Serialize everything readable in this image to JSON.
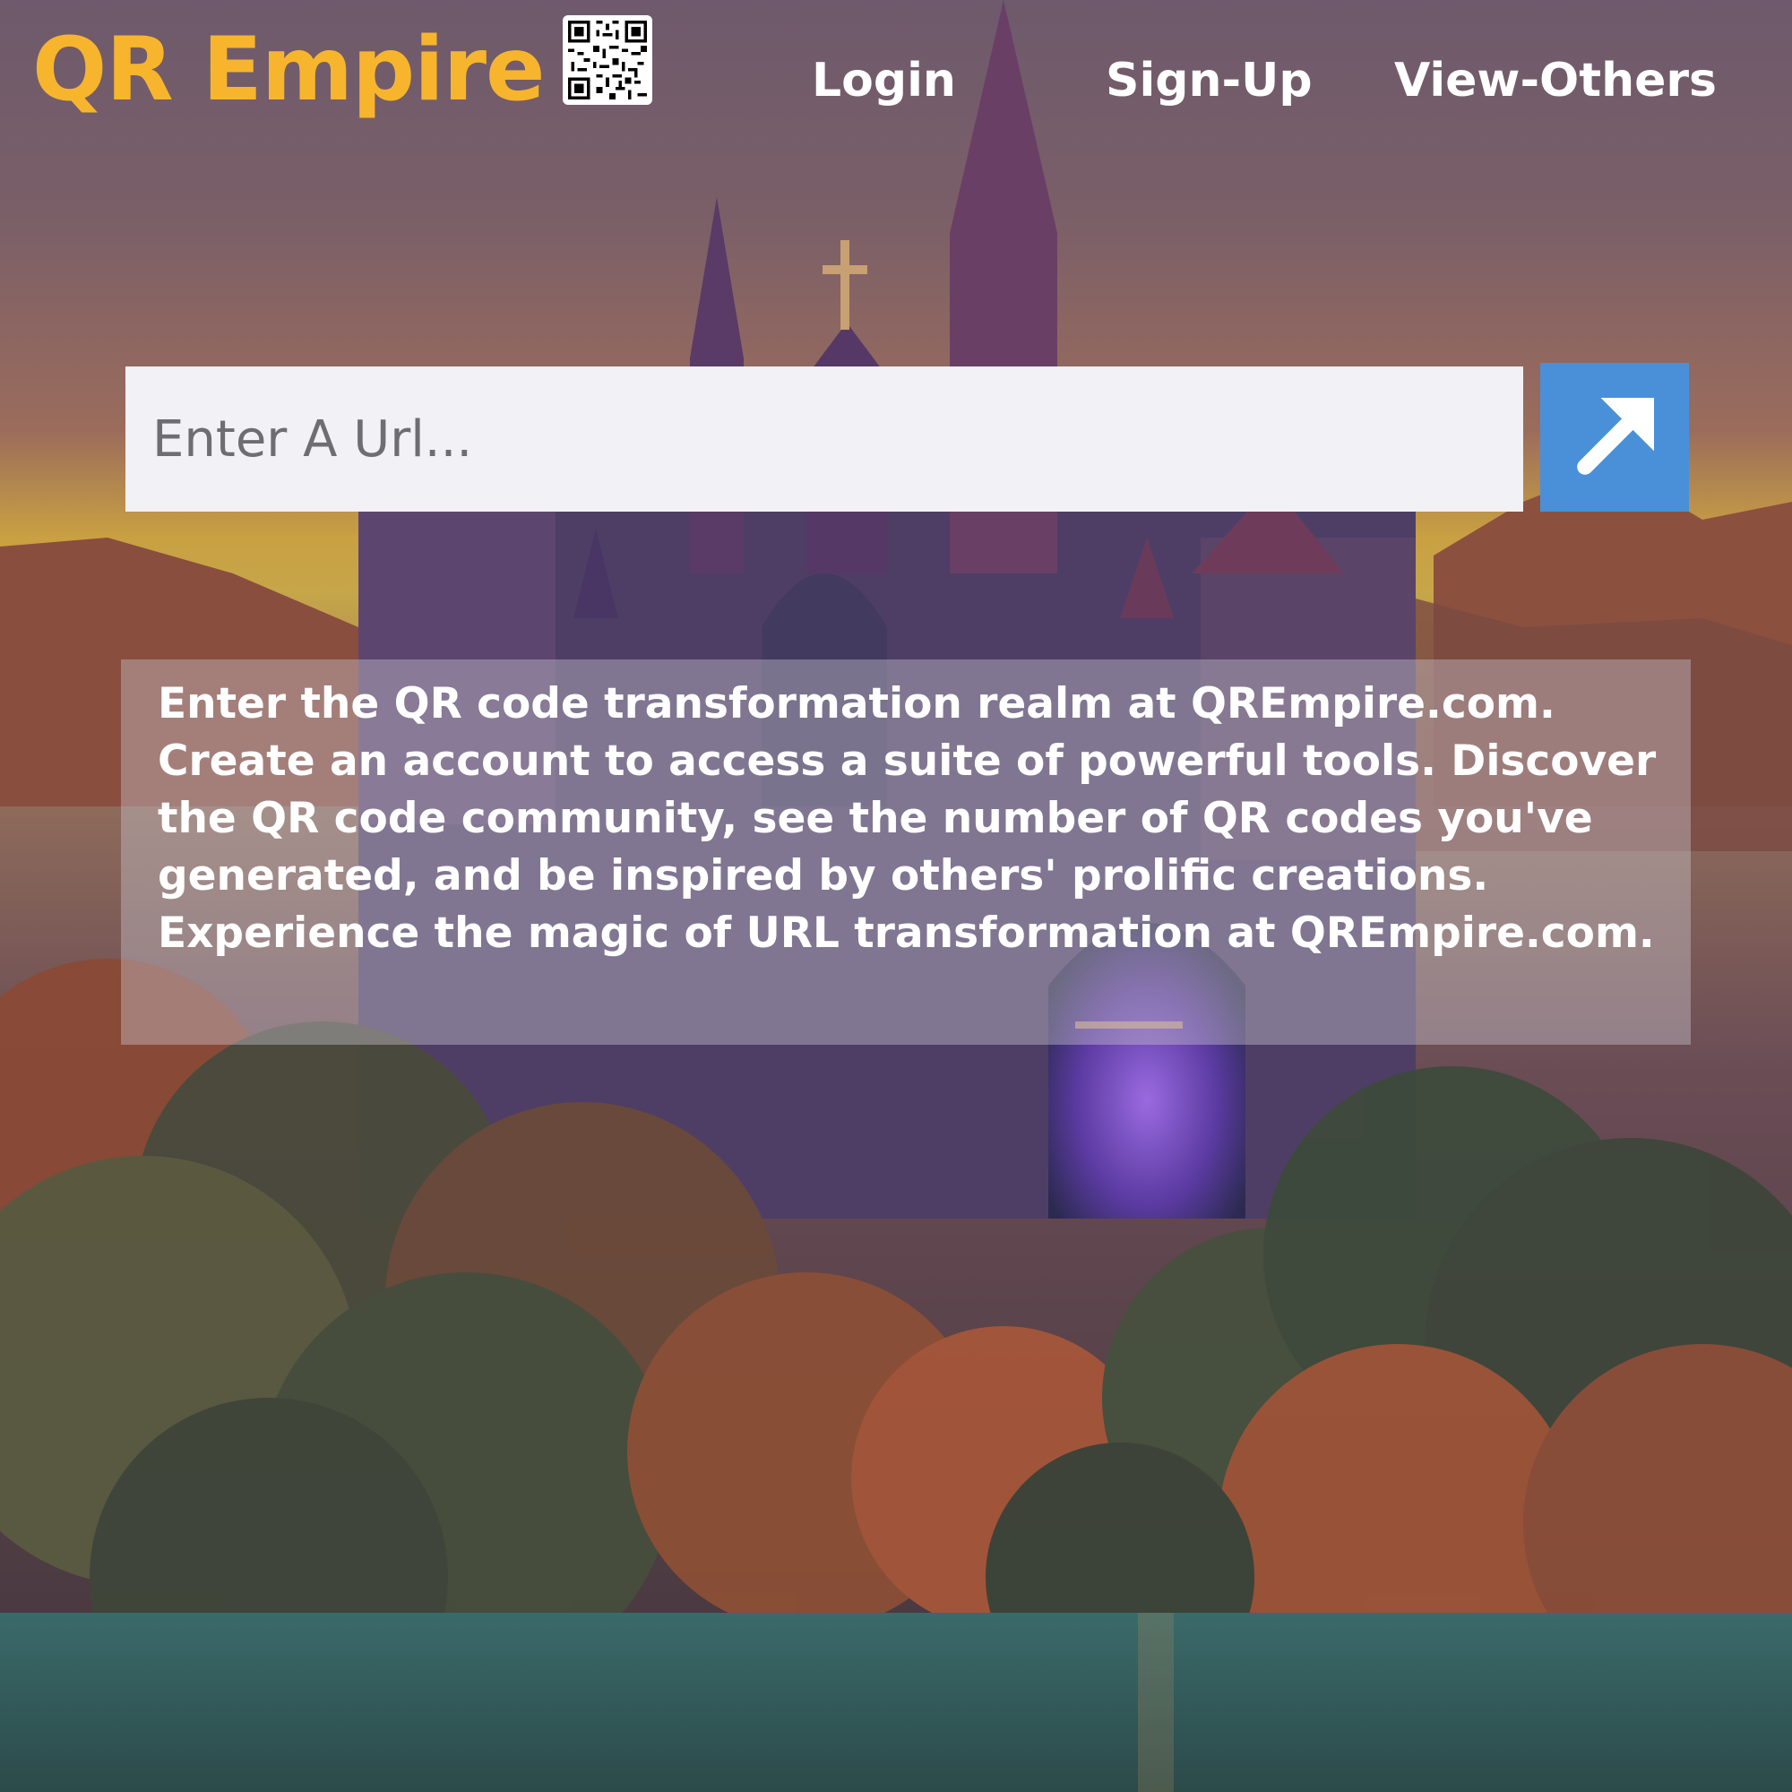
{
  "brand": {
    "title": "QR Empire",
    "title_color": "#f7b52e"
  },
  "nav": {
    "login": "Login",
    "signup": "Sign-Up",
    "view_others": "View-Others"
  },
  "search": {
    "placeholder": "Enter A Url...",
    "value": "",
    "submit_icon": "arrow-up-right-icon",
    "button_color": "#4a90d9"
  },
  "info": {
    "text": "Enter the QR code transformation realm at QREmpire.com. Create an account to access a suite of powerful tools. Discover the QR code community, see the number of QR codes you've generated, and be inspired by others' prolific creations. Experience the magic of URL transformation at QREmpire.com."
  },
  "icons": {
    "logo": "qr-code-icon",
    "background": "fantasy-castle-illustration"
  }
}
